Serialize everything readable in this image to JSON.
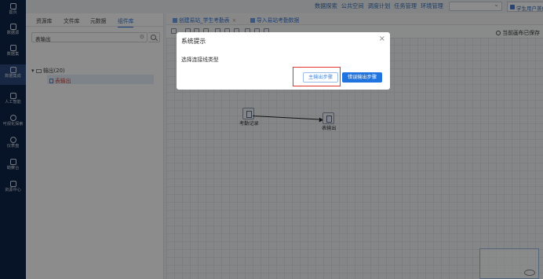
{
  "nav": {
    "items": [
      {
        "label": "首页",
        "icon": "home-icon"
      },
      {
        "label": "数据源",
        "icon": "database-icon"
      },
      {
        "label": "数据集",
        "icon": "dataset-icon"
      },
      {
        "label": "数据集成",
        "icon": "integration-icon",
        "active": true
      },
      {
        "label": "人工智能",
        "icon": "ai-icon"
      },
      {
        "label": "可视化探索",
        "icon": "chart-pie-icon"
      },
      {
        "label": "仪表盘",
        "icon": "dashboard-icon"
      },
      {
        "label": "勘察台",
        "icon": "graph-icon"
      },
      {
        "label": "资源中心",
        "icon": "resource-icon"
      }
    ]
  },
  "header": {
    "menu": [
      "数据探索",
      "公共空间",
      "调度计划",
      "任务管理",
      "环境管理"
    ],
    "user": "学生用户蒸修科"
  },
  "panel": {
    "tabs": [
      "资源库",
      "文件库",
      "元数据",
      "组件库"
    ],
    "search_value": "表输出",
    "folder": "输出(20)",
    "leaf": "表输出"
  },
  "editor": {
    "tabs": [
      "创建易站_学生考勤表",
      "导入易站考勤数据"
    ],
    "save_status": "当前画布已保存",
    "nodes": {
      "source": "考勤记录",
      "target": "表输出"
    }
  },
  "dialog": {
    "title": "系统提示",
    "message": "选择连接线类型",
    "primary_output": "主输出步骤",
    "error_output": "错误输出步骤"
  },
  "colors": {
    "accent": "#1f74e0",
    "nav_bg": "#0e2446",
    "highlight": "#e0342c"
  }
}
